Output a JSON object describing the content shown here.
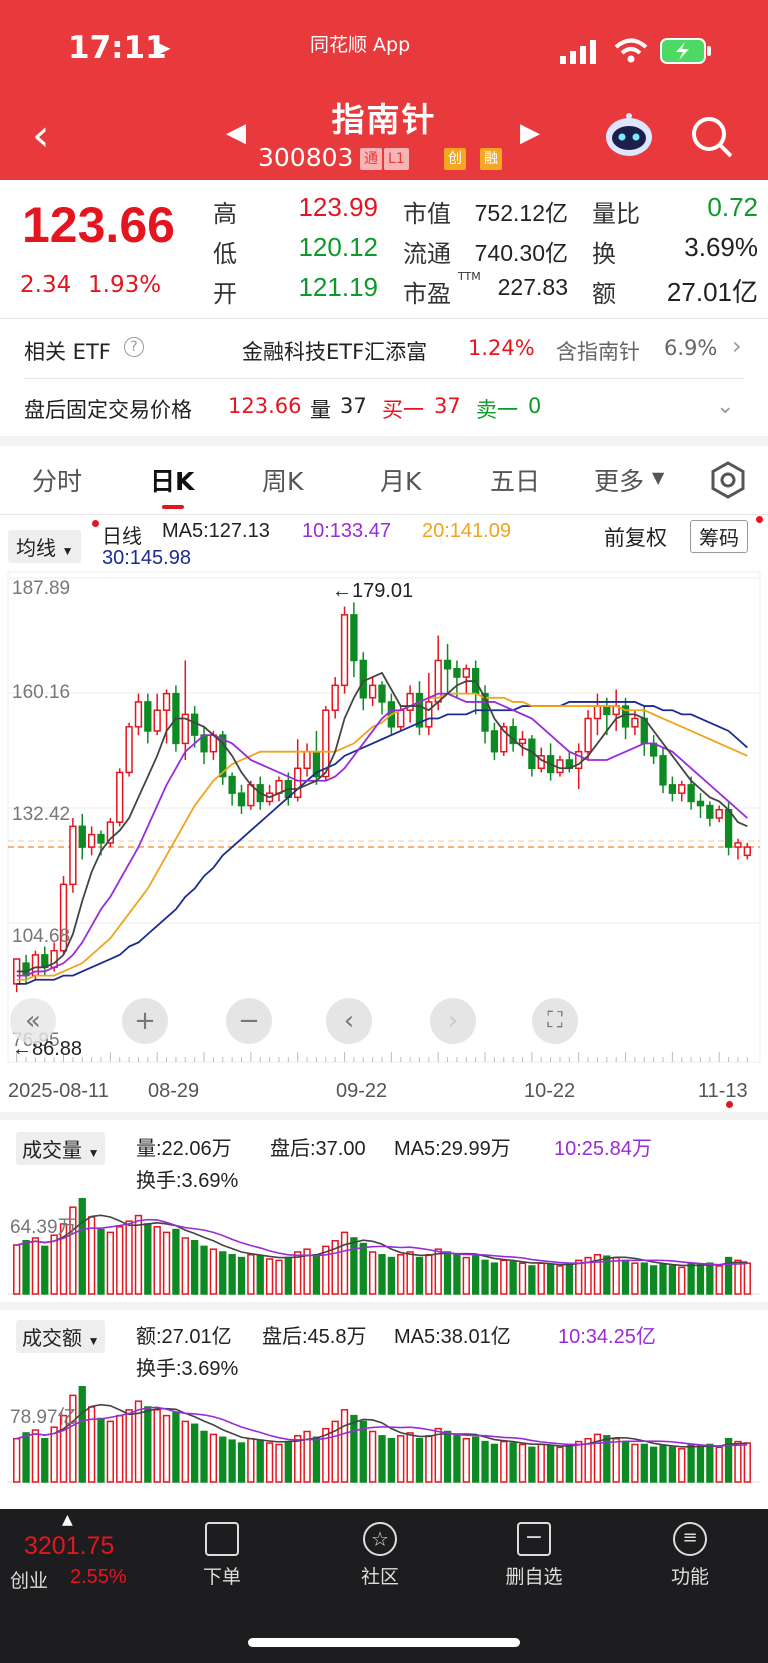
{
  "status": {
    "time": "17:11"
  },
  "header": {
    "app_label": "同花顺 App",
    "title": "指南针",
    "code": "300803",
    "tags": [
      "通",
      "L1",
      "创",
      "融"
    ]
  },
  "quote": {
    "price": "123.66",
    "change": "2.34",
    "change_pct": "1.93%",
    "high_label": "高",
    "high": "123.99",
    "low_label": "低",
    "low": "120.12",
    "open_label": "开",
    "open": "121.19",
    "mktcap_label": "市值",
    "mktcap": "752.12亿",
    "float_label": "流通",
    "float": "740.30亿",
    "pe_label": "市盈",
    "pe_sup": "TTM",
    "pe": "227.83",
    "volratio_label": "量比",
    "volratio": "0.72",
    "turnover_label": "换",
    "turnover": "3.69%",
    "amount_label": "额",
    "amount": "27.01亿"
  },
  "etf": {
    "label": "相关 ETF",
    "help": "?",
    "name": "金融科技ETF汇添富",
    "pct": "1.24%",
    "hold": "含指南针",
    "hold_pct": "6.9%"
  },
  "afterhours": {
    "label": "盘后固定交易价格",
    "price": "123.66",
    "vol_label": "量",
    "vol": "37",
    "buy_label": "买一",
    "buy": "37",
    "sell_label": "卖一",
    "sell": "0"
  },
  "tabs": [
    "分时",
    "日K",
    "周K",
    "月K",
    "五日",
    "更多"
  ],
  "active_tab": "日K",
  "kline": {
    "ma_select": "均线",
    "period": "日线",
    "ma5": "MA5:127.13",
    "ma10": "10:133.47",
    "ma20": "20:141.09",
    "ma30": "30:145.98",
    "fq": "前复权",
    "chips": "筹码",
    "high_mark": "←179.01",
    "low_mark": "←86.88",
    "y_ticks": [
      "187.89",
      "160.16",
      "132.42",
      "104.68",
      "76.95"
    ],
    "dates": [
      "2025-08-11",
      "08-29",
      "09-22",
      "10-22",
      "11-13"
    ]
  },
  "volume": {
    "select": "成交量",
    "vol": "量:22.06万",
    "after": "盘后:37.00",
    "ma5": "MA5:29.99万",
    "ma10": "10:25.84万",
    "turnover": "换手:3.69%",
    "tick": "64.39万"
  },
  "amount": {
    "select": "成交额",
    "amt": "额:27.01亿",
    "after": "盘后:45.8万",
    "ma5": "MA5:38.01亿",
    "ma10": "10:34.25亿",
    "turnover": "换手:3.69%",
    "tick": "78.97亿"
  },
  "bottom": {
    "index_value": "3201.75",
    "index_name": "创业",
    "index_pct": "2.55%",
    "nav": [
      "下单",
      "社区",
      "删自选",
      "功能"
    ]
  },
  "chart_data": {
    "type": "candlestick",
    "title": "",
    "y_range": [
      76.95,
      187.89
    ],
    "candles": [
      [
        90,
        96,
        88,
        95
      ],
      [
        95,
        92,
        90,
        97
      ],
      [
        92,
        97,
        91,
        98
      ],
      [
        97,
        94,
        92,
        99
      ],
      [
        94,
        98,
        93,
        100
      ],
      [
        98,
        114,
        97,
        116
      ],
      [
        114,
        128,
        112,
        130
      ],
      [
        128,
        123,
        120,
        131
      ],
      [
        123,
        126,
        121,
        128
      ],
      [
        126,
        124,
        121,
        127
      ],
      [
        124,
        129,
        123,
        130
      ],
      [
        129,
        141,
        128,
        142
      ],
      [
        141,
        152,
        140,
        153
      ],
      [
        152,
        158,
        150,
        160
      ],
      [
        158,
        151,
        148,
        160
      ],
      [
        151,
        156,
        150,
        160
      ],
      [
        156,
        160,
        148,
        161
      ],
      [
        160,
        148,
        146,
        162
      ],
      [
        148,
        155,
        144,
        168
      ],
      [
        155,
        150,
        147,
        157
      ],
      [
        150,
        146,
        143,
        152
      ],
      [
        146,
        150,
        144,
        151
      ],
      [
        150,
        140,
        138,
        151
      ],
      [
        140,
        136,
        133,
        141
      ],
      [
        136,
        133,
        131,
        138
      ],
      [
        133,
        138,
        132,
        139
      ],
      [
        138,
        134,
        132,
        140
      ],
      [
        134,
        136,
        133,
        138
      ],
      [
        136,
        139,
        134,
        140
      ],
      [
        139,
        135,
        133,
        141
      ],
      [
        135,
        142,
        134,
        149
      ],
      [
        142,
        146,
        140,
        148
      ],
      [
        146,
        140,
        138,
        151
      ],
      [
        140,
        156,
        139,
        157
      ],
      [
        156,
        162,
        154,
        164
      ],
      [
        162,
        179,
        160,
        181
      ],
      [
        179,
        168,
        164,
        182
      ],
      [
        168,
        159,
        156,
        170
      ],
      [
        159,
        162,
        157,
        164
      ],
      [
        162,
        158,
        155,
        163
      ],
      [
        158,
        152,
        150,
        160
      ],
      [
        152,
        156,
        151,
        157
      ],
      [
        156,
        160,
        153,
        162
      ],
      [
        160,
        152,
        150,
        163
      ],
      [
        152,
        158,
        150,
        165
      ],
      [
        158,
        168,
        156,
        174
      ],
      [
        168,
        166,
        160,
        172
      ],
      [
        166,
        164,
        159,
        168
      ],
      [
        164,
        166,
        160,
        167
      ],
      [
        166,
        160,
        155,
        168
      ],
      [
        160,
        151,
        148,
        162
      ],
      [
        151,
        146,
        144,
        153
      ],
      [
        146,
        152,
        145,
        153
      ],
      [
        152,
        148,
        146,
        154
      ],
      [
        148,
        149,
        145,
        151
      ],
      [
        149,
        142,
        140,
        150
      ],
      [
        142,
        145,
        141,
        147
      ],
      [
        145,
        141,
        139,
        148
      ],
      [
        141,
        144,
        140,
        145
      ],
      [
        144,
        142,
        141,
        146
      ],
      [
        142,
        146,
        137,
        148
      ],
      [
        146,
        154,
        144,
        156
      ],
      [
        154,
        157,
        150,
        160
      ],
      [
        157,
        155,
        150,
        159
      ],
      [
        155,
        157,
        151,
        161
      ],
      [
        157,
        152,
        149,
        159
      ],
      [
        152,
        154,
        150,
        156
      ],
      [
        154,
        148,
        145,
        157
      ],
      [
        148,
        145,
        143,
        150
      ],
      [
        145,
        138,
        136,
        147
      ],
      [
        138,
        136,
        134,
        140
      ],
      [
        136,
        138,
        134,
        139
      ],
      [
        138,
        134,
        132,
        140
      ],
      [
        134,
        133,
        130,
        136
      ],
      [
        133,
        130,
        128,
        134
      ],
      [
        130,
        132,
        129,
        133
      ],
      [
        132,
        123,
        121,
        134
      ],
      [
        123,
        124,
        120,
        125
      ],
      [
        121,
        123,
        120,
        124
      ]
    ],
    "ma5": [
      93,
      93,
      94,
      94,
      95,
      97,
      102,
      110,
      117,
      122,
      125,
      127,
      130,
      135,
      140,
      145,
      151,
      154,
      154,
      153,
      152,
      150,
      148,
      145,
      141,
      138,
      136,
      135,
      136,
      137,
      137,
      138,
      139,
      141,
      146,
      154,
      159,
      163,
      164,
      165,
      161,
      157,
      157,
      157,
      156,
      158,
      160,
      162,
      163,
      163,
      159,
      154,
      151,
      149,
      147,
      146,
      144,
      143,
      142,
      142,
      143,
      145,
      148,
      151,
      154,
      155,
      155,
      154,
      151,
      148,
      145,
      142,
      139,
      137,
      135,
      134,
      132,
      129,
      128
    ],
    "ma10": [
      92,
      92,
      93,
      93,
      94,
      95,
      97,
      100,
      104,
      108,
      111,
      115,
      119,
      123,
      128,
      133,
      138,
      142,
      146,
      148,
      150,
      150,
      149,
      148,
      146,
      144,
      143,
      142,
      141,
      140,
      139,
      139,
      139,
      139,
      140,
      142,
      145,
      148,
      151,
      154,
      156,
      156,
      157,
      158,
      159,
      160,
      160,
      159,
      158,
      158,
      158,
      158,
      157,
      156,
      155,
      154,
      152,
      150,
      148,
      146,
      145,
      144,
      144,
      144,
      145,
      146,
      147,
      148,
      148,
      147,
      146,
      144,
      142,
      140,
      138,
      136,
      134,
      132,
      130
    ],
    "ma20": [
      91,
      91,
      92,
      92,
      92,
      93,
      94,
      95,
      97,
      99,
      101,
      104,
      107,
      110,
      113,
      117,
      121,
      125,
      129,
      133,
      136,
      139,
      141,
      143,
      144,
      145,
      146,
      146,
      146,
      146,
      146,
      146,
      146,
      146,
      146,
      147,
      148,
      150,
      152,
      153,
      155,
      156,
      157,
      158,
      159,
      159,
      160,
      160,
      160,
      160,
      159,
      159,
      159,
      158,
      158,
      157,
      157,
      157,
      157,
      157,
      157,
      157,
      157,
      157,
      157,
      156,
      156,
      156,
      155,
      154,
      153,
      152,
      151,
      150,
      149,
      148,
      147,
      146,
      145
    ],
    "ma30": [
      90,
      90,
      91,
      91,
      91,
      92,
      92,
      93,
      94,
      95,
      96,
      97,
      99,
      100,
      102,
      104,
      106,
      108,
      111,
      113,
      116,
      118,
      121,
      123,
      125,
      127,
      129,
      131,
      133,
      135,
      137,
      139,
      141,
      142,
      143,
      145,
      146,
      147,
      148,
      149,
      150,
      151,
      152,
      153,
      154,
      154,
      155,
      155,
      155,
      156,
      156,
      156,
      156,
      156,
      157,
      157,
      157,
      157,
      157,
      158,
      158,
      158,
      158,
      158,
      158,
      158,
      158,
      157,
      157,
      156,
      156,
      155,
      155,
      154,
      153,
      152,
      151,
      149,
      147
    ],
    "volume": [
      35,
      38,
      40,
      34,
      42,
      50,
      62,
      68,
      55,
      46,
      44,
      48,
      52,
      56,
      50,
      48,
      44,
      46,
      40,
      38,
      34,
      32,
      30,
      28,
      26,
      28,
      27,
      25,
      24,
      26,
      30,
      32,
      28,
      34,
      38,
      44,
      40,
      36,
      30,
      28,
      26,
      28,
      30,
      26,
      28,
      32,
      30,
      28,
      26,
      27,
      24,
      22,
      24,
      23,
      22,
      20,
      22,
      21,
      20,
      22,
      24,
      26,
      28,
      27,
      26,
      24,
      22,
      22,
      20,
      21,
      20,
      19,
      22,
      21,
      22,
      20,
      26,
      24,
      22
    ],
    "amount": [
      30,
      34,
      36,
      30,
      38,
      46,
      60,
      66,
      52,
      44,
      42,
      46,
      50,
      56,
      52,
      50,
      46,
      48,
      42,
      40,
      35,
      33,
      31,
      29,
      27,
      30,
      29,
      27,
      26,
      28,
      32,
      35,
      31,
      37,
      42,
      50,
      46,
      42,
      35,
      32,
      30,
      32,
      34,
      30,
      32,
      37,
      35,
      32,
      30,
      31,
      28,
      26,
      28,
      27,
      26,
      24,
      26,
      25,
      24,
      26,
      28,
      30,
      33,
      32,
      30,
      28,
      26,
      26,
      24,
      25,
      24,
      23,
      26,
      25,
      26,
      24,
      30,
      28,
      27
    ]
  }
}
